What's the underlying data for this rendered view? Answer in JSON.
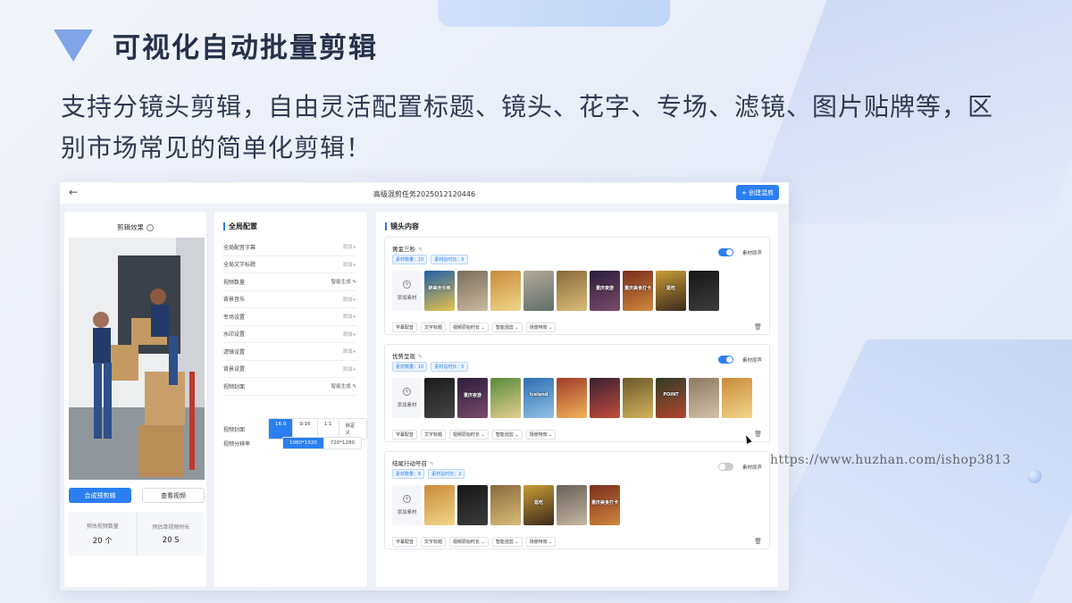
{
  "slide": {
    "heading": "可视化自动批量剪辑",
    "subtitle": "支持分镜头剪辑，自由灵活配置标题、镜头、花字、专场、滤镜、图片贴牌等，区别市场常见的简单化剪辑！",
    "watermark": "https://www.huzhan.com/ishop3813"
  },
  "app": {
    "back_icon": "←",
    "title": "高级混剪任务2025012120446",
    "create_button": "+ 创建混剪",
    "preview_panel": {
      "title": "剪辑效果",
      "info_icon": "i",
      "compose_button": "合成预剪辑",
      "view_button": "查看视频",
      "stats": [
        {
          "label": "预估视频数量",
          "value": "20 个"
        },
        {
          "label": "预估单视频时长",
          "value": "20 S"
        }
      ]
    },
    "global_panel": {
      "title": "全局配置",
      "rows": [
        {
          "label": "全局配音字幕",
          "action": "添加+"
        },
        {
          "label": "全局文字标题",
          "action": "添加+"
        },
        {
          "label": "视频数量",
          "action": "智能生成 ✎"
        },
        {
          "label": "背景音乐",
          "action": "添加+"
        },
        {
          "label": "专场设置",
          "action": "添加+"
        },
        {
          "label": "水印设置",
          "action": "添加+"
        },
        {
          "label": "滤镜设置",
          "action": "添加+"
        },
        {
          "label": "背景设置",
          "action": "添加+"
        },
        {
          "label": "视频封面",
          "action": "智能生成 ✎"
        }
      ],
      "ratio": {
        "label": "视频封面",
        "options": [
          "16:9",
          "9:16",
          "1:1",
          "自定义"
        ],
        "selected": "16:9"
      },
      "resolution": {
        "label": "视频分辨率",
        "options": [
          "1080*1920",
          "720*1280"
        ],
        "selected": "1080*1920"
      }
    },
    "shots_panel": {
      "title": "镜头内容",
      "add_label": "添加素材",
      "mute_label": "素材原声",
      "tooltip": "删除",
      "chips": [
        "字幕配音",
        "文字标题",
        "视频原始时长 ⌄",
        "智能混剪 ⌄",
        "场景特效 ⌄"
      ],
      "shots": [
        {
          "name": "黄金三秒",
          "tags": [
            "素材数量：10",
            "素材总时长：5"
          ],
          "mute_on": true,
          "thumbs": [
            {
              "colors": [
                "#1f5fa8",
                "#e8c24a"
              ],
              "caption": "醉美赤长峡"
            },
            {
              "colors": [
                "#7a6d5c",
                "#c9b9a0"
              ],
              "caption": ""
            },
            {
              "colors": [
                "#c98a3a",
                "#f1d68a"
              ],
              "caption": ""
            },
            {
              "colors": [
                "#b4a99a",
                "#5f6e6a"
              ],
              "caption": ""
            },
            {
              "colors": [
                "#8a6a3c",
                "#d9bb78"
              ],
              "caption": ""
            },
            {
              "colors": [
                "#2a1e3a",
                "#7b4a6a"
              ],
              "caption": "重庆夜游"
            },
            {
              "colors": [
                "#7a2e1c",
                "#d1873c"
              ],
              "caption": "重庆美食打卡"
            },
            {
              "colors": [
                "#c99c36",
                "#3a2a1c"
              ],
              "caption": "逛吃"
            },
            {
              "colors": [
                "#161616",
                "#3c3c3c"
              ],
              "caption": ""
            }
          ]
        },
        {
          "name": "优势呈现",
          "tags": [
            "素材数量：10",
            "素材总时长：5"
          ],
          "mute_on": true,
          "thumbs": [
            {
              "colors": [
                "#1b1b1b",
                "#464646"
              ],
              "caption": ""
            },
            {
              "colors": [
                "#2a1e3a",
                "#7b4a6a"
              ],
              "caption": "重庆夜游"
            },
            {
              "colors": [
                "#5a8a3c",
                "#e3cf8e"
              ],
              "caption": ""
            },
            {
              "colors": [
                "#2d6fb2",
                "#93c1e6"
              ],
              "caption": "Iceland"
            },
            {
              "colors": [
                "#a03b2a",
                "#f0b457"
              ],
              "caption": ""
            },
            {
              "colors": [
                "#3a2030",
                "#c44c3c"
              ],
              "caption": ""
            },
            {
              "colors": [
                "#6b5a2c",
                "#d4b25c"
              ],
              "caption": ""
            },
            {
              "colors": [
                "#2f3d2a",
                "#b3462c"
              ],
              "caption": "POINT"
            },
            {
              "colors": [
                "#8b7a62",
                "#d2c2a8"
              ],
              "caption": ""
            },
            {
              "colors": [
                "#c98a3a",
                "#f1d68a"
              ],
              "caption": ""
            }
          ]
        },
        {
          "name": "结尾行动号召",
          "tags": [
            "素材数量：6",
            "素材总时长：2"
          ],
          "mute_on": false,
          "thumbs": [
            {
              "colors": [
                "#c98a3a",
                "#f1d68a"
              ],
              "caption": ""
            },
            {
              "colors": [
                "#161616",
                "#3c3c3c"
              ],
              "caption": ""
            },
            {
              "colors": [
                "#8a6a3c",
                "#d9bb78"
              ],
              "caption": ""
            },
            {
              "colors": [
                "#c99c36",
                "#3a2a1c"
              ],
              "caption": "逛吃"
            },
            {
              "colors": [
                "#6a5f58",
                "#c5b7a4"
              ],
              "caption": ""
            },
            {
              "colors": [
                "#7a2e1c",
                "#d1873c"
              ],
              "caption": "重庆美食打卡"
            }
          ]
        }
      ]
    }
  }
}
